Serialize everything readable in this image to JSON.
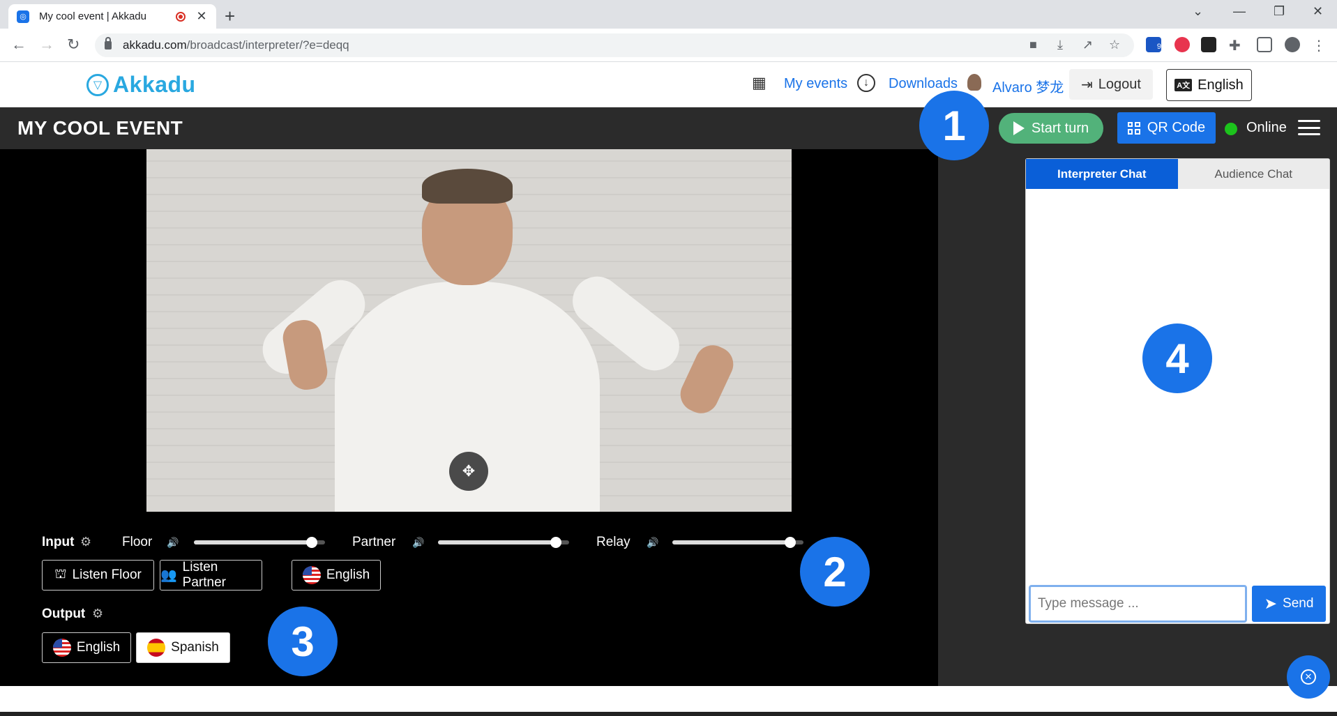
{
  "browser": {
    "tab_title": "My cool event | Akkadu",
    "url_domain": "akkadu.com",
    "url_path": "/broadcast/interpreter/?e=deqq",
    "extension_badge": "9"
  },
  "header": {
    "logo_text": "Akkadu",
    "my_events": "My events",
    "downloads": "Downloads",
    "user_name": "Alvaro 梦龙",
    "logout": "Logout",
    "language": "English"
  },
  "event_bar": {
    "title": "MY COOL EVENT",
    "start_turn": "Start turn",
    "qr_code": "QR Code",
    "status": "Online",
    "status_color": "#1cc31c"
  },
  "controls": {
    "input_label": "Input",
    "output_label": "Output",
    "sliders": [
      {
        "label": "Floor",
        "level": 0.9
      },
      {
        "label": "Partner",
        "level": 0.9
      },
      {
        "label": "Relay",
        "level": 0.9
      }
    ],
    "input_buttons": [
      "Listen Floor",
      "Listen Partner",
      "English"
    ],
    "output_buttons": [
      "English",
      "Spanish"
    ]
  },
  "chat": {
    "tab_interpreter": "Interpreter Chat",
    "tab_audience": "Audience Chat",
    "placeholder": "Type message ...",
    "send": "Send"
  },
  "badges": [
    "1",
    "2",
    "3",
    "4"
  ],
  "colors": {
    "accent": "#1a73e8",
    "start_turn": "#52b27a",
    "logo": "#29a8e0"
  }
}
